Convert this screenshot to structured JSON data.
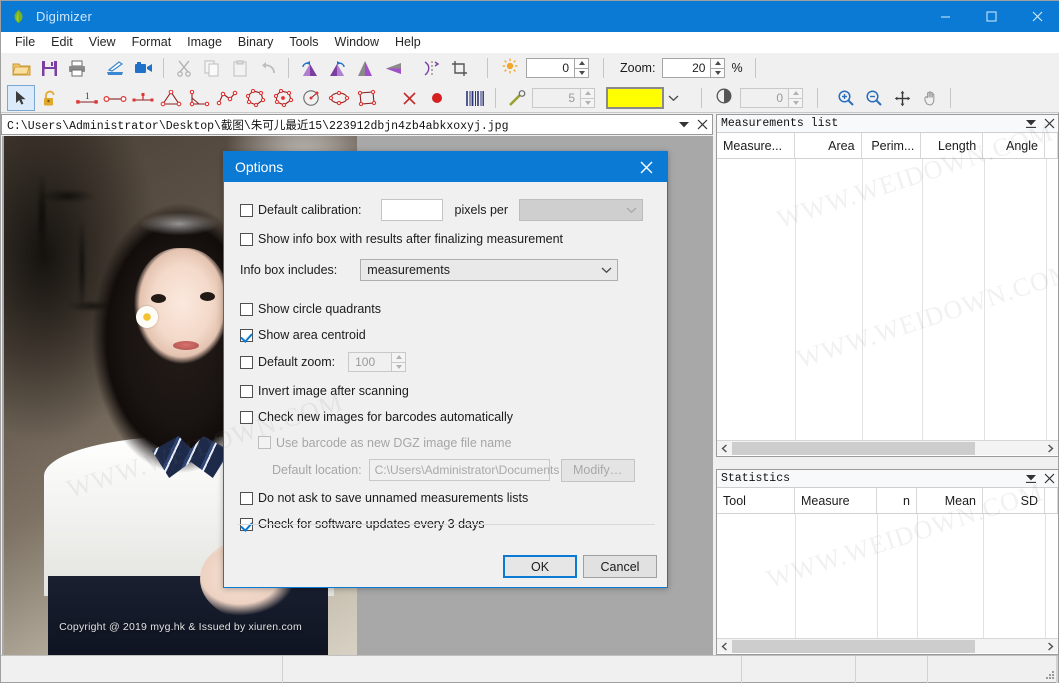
{
  "window": {
    "title": "Digimizer",
    "icon": "leaf-icon",
    "accent": "#0b7ad4",
    "controls": {
      "minimize": "minimize-icon",
      "maximize": "maximize-icon",
      "close": "close-icon"
    }
  },
  "menubar": {
    "items": [
      "File",
      "Edit",
      "View",
      "Format",
      "Image",
      "Binary",
      "Tools",
      "Window",
      "Help"
    ]
  },
  "toolbar": {
    "row1_icons": [
      "open-folder-icon",
      "save-icon",
      "print-icon",
      "scanner-icon",
      "camera-icon",
      "cut-icon",
      "copy-icon",
      "paste-icon",
      "undo-icon",
      "rotate-left-icon",
      "rotate-right-icon",
      "flip-horizontal-icon",
      "flip-vertical-icon",
      "mirror-icon",
      "crop-icon"
    ],
    "row2_icons": [
      "arrow-select-icon",
      "lock-icon",
      "calibrate-icon",
      "distance-icon",
      "perpendicular-distance-icon",
      "angle-icon",
      "angle-3point-icon",
      "polyline-icon",
      "polygon-icon",
      "freehand-area-icon",
      "circle-icon",
      "ellipse-icon",
      "rectangle-icon",
      "delete-icon",
      "point-marker-icon",
      "barcode-icon",
      "magic-wand-icon"
    ],
    "pen_width": "5",
    "color_swatch": "#ffff00",
    "brightness_label": "brightness-icon",
    "brightness_value": "0",
    "contrast_label": "contrast-icon",
    "contrast_value": "0",
    "zoom_label": "Zoom:",
    "zoom_value": "20",
    "zoom_unit": "%",
    "view_icons": [
      "zoom-in-icon",
      "zoom-out-icon",
      "pan-icon",
      "hand-icon"
    ]
  },
  "filetab": {
    "path": "C:\\Users\\Administrator\\Desktop\\截图\\朱可儿最近15\\223912dbjn4zb4abkxoxyj.jpg",
    "dropdown_icon": "chevron-down-icon",
    "close_icon": "close-icon"
  },
  "canvas": {
    "background": "#a8a8a8",
    "image_watermark": "Copyright @ 2019 myg.hk & Issued by xiuren.com"
  },
  "dialog": {
    "title": "Options",
    "close_icon": "close-icon",
    "default_calibration": {
      "label": "Default calibration:",
      "checked": false,
      "value": "",
      "unit_label": "pixels per",
      "unit_value": "",
      "unit_enabled": false
    },
    "show_info_box": {
      "label": "Show info box with results after finalizing measurement",
      "checked": false
    },
    "info_box_includes": {
      "label": "Info box includes:",
      "value": "measurements"
    },
    "show_circle_quadrants": {
      "label": "Show circle quadrants",
      "checked": false
    },
    "show_area_centroid": {
      "label": "Show area centroid",
      "checked": true
    },
    "default_zoom": {
      "label": "Default zoom:",
      "checked": false,
      "value": "100"
    },
    "invert_image": {
      "label": "Invert image after scanning",
      "checked": false
    },
    "check_barcodes": {
      "label": "Check new images for barcodes automatically",
      "checked": false
    },
    "use_barcode_name": {
      "label": "Use barcode as new DGZ image file name",
      "checked": false,
      "enabled": false
    },
    "default_location": {
      "label": "Default location:",
      "value": "C:\\Users\\Administrator\\Documents",
      "button": "Modify…",
      "enabled": false
    },
    "do_not_ask_save": {
      "label": "Do not ask to save unnamed measurements lists",
      "checked": false
    },
    "check_updates": {
      "label": "Check for software updates every 3 days",
      "checked": true
    },
    "ok_button": "OK",
    "cancel_button": "Cancel"
  },
  "measurements_panel": {
    "title": "Measurements list",
    "menu_icon": "panel-menu-icon",
    "close_icon": "close-icon",
    "columns": [
      "Measure...",
      "Area",
      "Perim...",
      "Length",
      "Angle"
    ],
    "rows": [],
    "scroll_left_icon": "chevron-left-icon",
    "scroll_right_icon": "chevron-right-icon"
  },
  "statistics_panel": {
    "title": "Statistics",
    "menu_icon": "panel-menu-icon",
    "close_icon": "close-icon",
    "columns": [
      "Tool",
      "Measure",
      "n",
      "Mean",
      "SD"
    ],
    "rows": [],
    "scroll_left_icon": "chevron-left-icon",
    "scroll_right_icon": "chevron-right-icon"
  },
  "statusbar": {
    "cells": [
      "",
      "",
      "",
      "",
      "",
      "",
      ""
    ]
  },
  "page_watermarks": [
    "WWW.WEIDOWN.COM",
    "WWW.WEIDOWN.COM",
    "WWW.WEIDOWN.COM",
    "WWW.WEIDOWN.COM"
  ]
}
